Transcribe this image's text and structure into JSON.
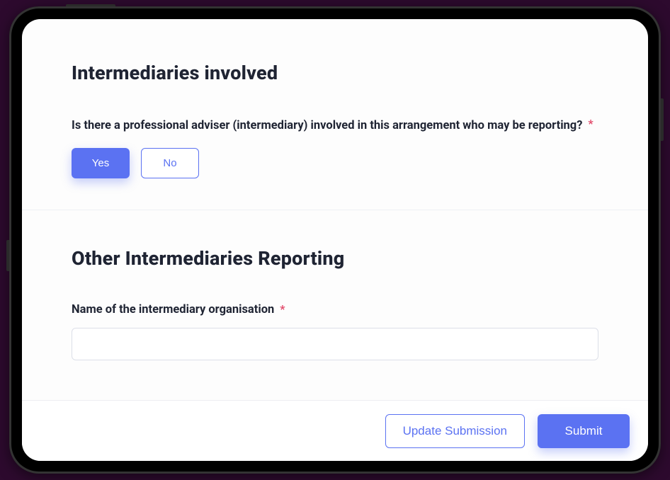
{
  "section1": {
    "title": "Intermediaries involved",
    "question": "Is there a professional adviser (intermediary) involved in this arrangement who may be reporting?",
    "required_mark": "*",
    "yes_label": "Yes",
    "no_label": "No",
    "selected": "Yes"
  },
  "section2": {
    "title": "Other Intermediaries Reporting",
    "field_label": "Name of the intermediary organisation",
    "required_mark": "*",
    "value": ""
  },
  "footer": {
    "update_label": "Update Submission",
    "submit_label": "Submit"
  }
}
